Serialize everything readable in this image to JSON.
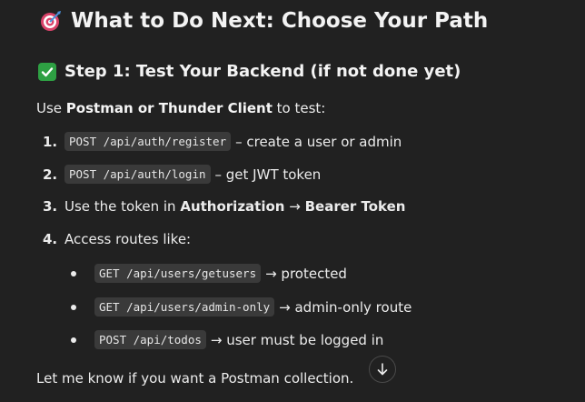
{
  "heading": {
    "icon": "direct-hit-target-icon",
    "title": "What to Do Next: Choose Your Path"
  },
  "step": {
    "icon": "check-mark-button-icon",
    "title": "Step 1: Test Your Backend (if not done yet)"
  },
  "intro": {
    "prefix": "Use ",
    "bold": "Postman or Thunder Client",
    "suffix": " to test:"
  },
  "steps": [
    {
      "num": "1.",
      "code": "POST /api/auth/register",
      "text": "– create a user or admin"
    },
    {
      "num": "2.",
      "code": "POST /api/auth/login",
      "text": "– get JWT token"
    },
    {
      "num": "3.",
      "prefix": "Use the token in ",
      "bold1": "Authorization",
      "arrow": " → ",
      "bold2": "Bearer Token"
    },
    {
      "num": "4.",
      "text": "Access routes like:"
    }
  ],
  "routes": [
    {
      "code": "GET /api/users/getusers",
      "text": "→ protected"
    },
    {
      "code": "GET /api/users/admin-only",
      "text": "→ admin-only route"
    },
    {
      "code": "POST /api/todos",
      "text": "→ user must be logged in"
    }
  ],
  "footer": "Let me know if you want a Postman collection.",
  "scroll_button": {
    "icon": "arrow-down-icon"
  },
  "colors": {
    "background": "#212121",
    "text": "#ececec",
    "code_bg": "#3a3a3a",
    "check_green": "#2ea043"
  }
}
